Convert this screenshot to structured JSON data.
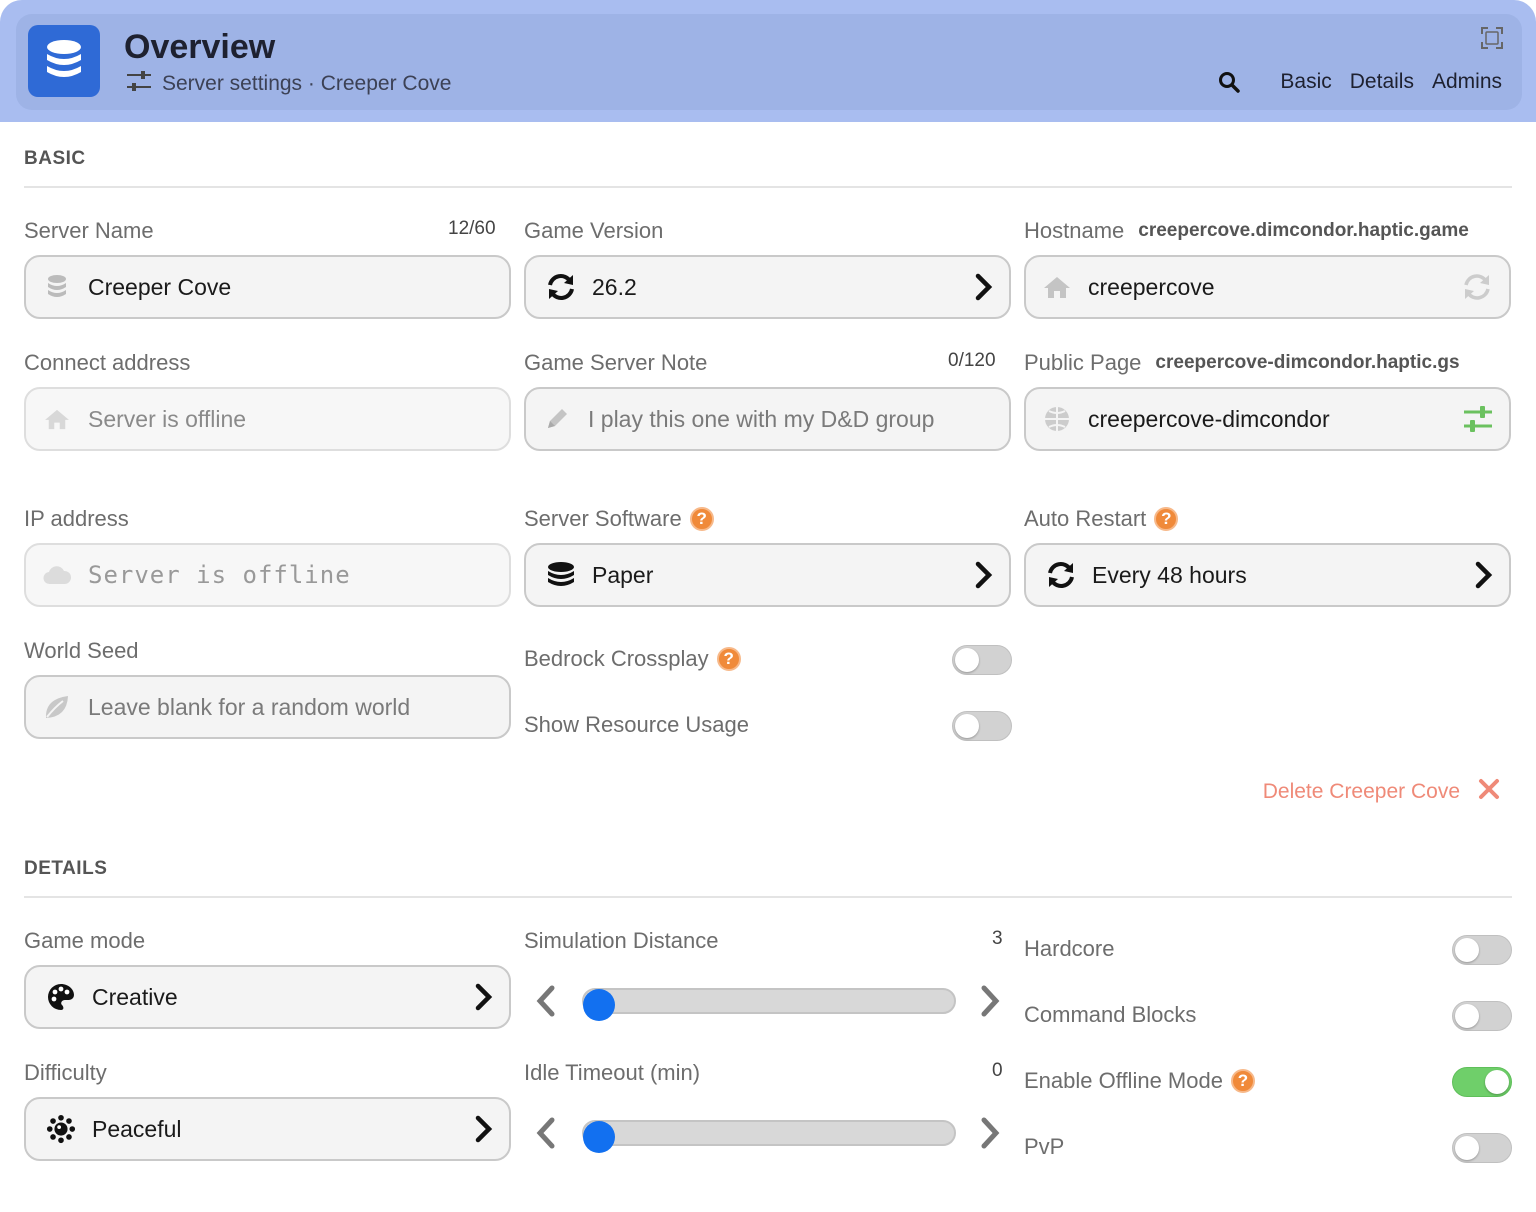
{
  "header": {
    "title": "Overview",
    "breadcrumb": "Server settings · Creeper Cove",
    "nav": [
      "Basic",
      "Details",
      "Admins"
    ]
  },
  "basic": {
    "section_title": "BASIC",
    "server_name": {
      "label": "Server Name",
      "counter": "12/60",
      "value": "Creeper Cove"
    },
    "game_version": {
      "label": "Game Version",
      "value": "26.2"
    },
    "hostname": {
      "label": "Hostname",
      "aside": "creepercove.dimcondor.haptic.game",
      "value": "creepercove"
    },
    "connect_address": {
      "label": "Connect address",
      "placeholder": "Server is offline"
    },
    "game_server_note": {
      "label": "Game Server Note",
      "counter": "0/120",
      "placeholder": "I play this one with my D&D group"
    },
    "public_page": {
      "label": "Public Page",
      "aside": "creepercove-dimcondor.haptic.gs",
      "value": "creepercove-dimcondor"
    },
    "ip_address": {
      "label": "IP address",
      "placeholder": "Server is offline"
    },
    "server_software": {
      "label": "Server Software",
      "value": "Paper"
    },
    "auto_restart": {
      "label": "Auto Restart",
      "value": "Every 48 hours"
    },
    "world_seed": {
      "label": "World Seed",
      "placeholder": "Leave blank for a random world"
    },
    "bedrock_crossplay": {
      "label": "Bedrock Crossplay",
      "enabled": false
    },
    "show_resource_usage": {
      "label": "Show Resource Usage",
      "enabled": false
    },
    "delete_label": "Delete Creeper Cove"
  },
  "details": {
    "section_title": "DETAILS",
    "game_mode": {
      "label": "Game mode",
      "value": "Creative"
    },
    "difficulty": {
      "label": "Difficulty",
      "value": "Peaceful"
    },
    "simulation_distance": {
      "label": "Simulation Distance",
      "value": "3",
      "fraction": 0.04
    },
    "idle_timeout": {
      "label": "Idle Timeout (min)",
      "value": "0",
      "fraction": 0.04
    },
    "hardcore": {
      "label": "Hardcore",
      "enabled": false
    },
    "command_blocks": {
      "label": "Command Blocks",
      "enabled": false
    },
    "offline_mode": {
      "label": "Enable Offline Mode",
      "enabled": true
    },
    "pvp": {
      "label": "PvP",
      "enabled": false
    }
  },
  "help_glyph": "?",
  "colors": {
    "accent": "#2f6ad6",
    "header": "#9eb3e6",
    "toggle_on": "#6fcf6a",
    "help": "#f08a3a",
    "danger": "#ef8a78",
    "slider": "#1270f0"
  }
}
